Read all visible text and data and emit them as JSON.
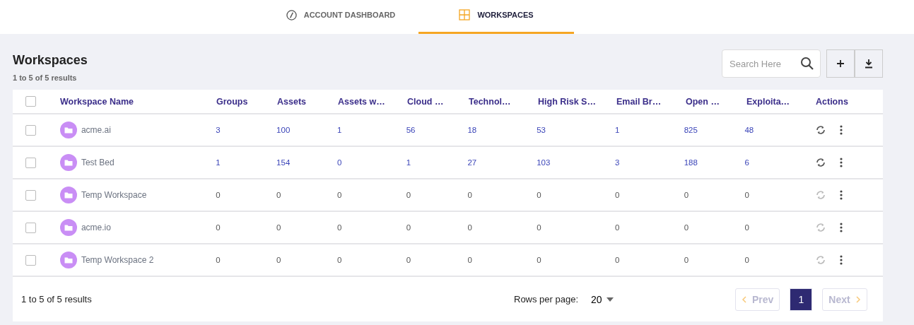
{
  "tabs": [
    {
      "label": "ACCOUNT DASHBOARD",
      "selected": false
    },
    {
      "label": "WORKSPACES",
      "selected": true
    }
  ],
  "page": {
    "title": "Workspaces",
    "subtitle": "1 to 5 of 5 results"
  },
  "search": {
    "placeholder": "Search Here"
  },
  "table": {
    "select_all_checked": false,
    "columns": [
      "Workspace Name",
      "Groups",
      "Assets",
      "Assets w…",
      "Cloud …",
      "Technol…",
      "High Risk S…",
      "Email Br…",
      "Open …",
      "Exploita…",
      "Actions"
    ],
    "rows": [
      {
        "checked": false,
        "name": "acme.ai",
        "active": true,
        "values": [
          "3",
          "100",
          "1",
          "56",
          "18",
          "53",
          "1",
          "825",
          "48"
        ]
      },
      {
        "checked": false,
        "name": "Test Bed",
        "active": true,
        "values": [
          "1",
          "154",
          "0",
          "1",
          "27",
          "103",
          "3",
          "188",
          "6"
        ]
      },
      {
        "checked": false,
        "name": "Temp Workspace",
        "active": false,
        "values": [
          "0",
          "0",
          "0",
          "0",
          "0",
          "0",
          "0",
          "0",
          "0"
        ]
      },
      {
        "checked": false,
        "name": "acme.io",
        "active": false,
        "values": [
          "0",
          "0",
          "0",
          "0",
          "0",
          "0",
          "0",
          "0",
          "0"
        ]
      },
      {
        "checked": false,
        "name": "Temp Workspace 2",
        "active": false,
        "values": [
          "0",
          "0",
          "0",
          "0",
          "0",
          "0",
          "0",
          "0",
          "0"
        ]
      }
    ]
  },
  "footer": {
    "results": "1 to 5 of 5  results",
    "rows_per_page_label": "Rows per page:",
    "rows_per_page": "20",
    "prev": {
      "label": "Prev",
      "disabled": true
    },
    "pages": [
      {
        "label": "1",
        "selected": true
      }
    ],
    "next": {
      "label": "Next",
      "disabled": true
    }
  }
}
